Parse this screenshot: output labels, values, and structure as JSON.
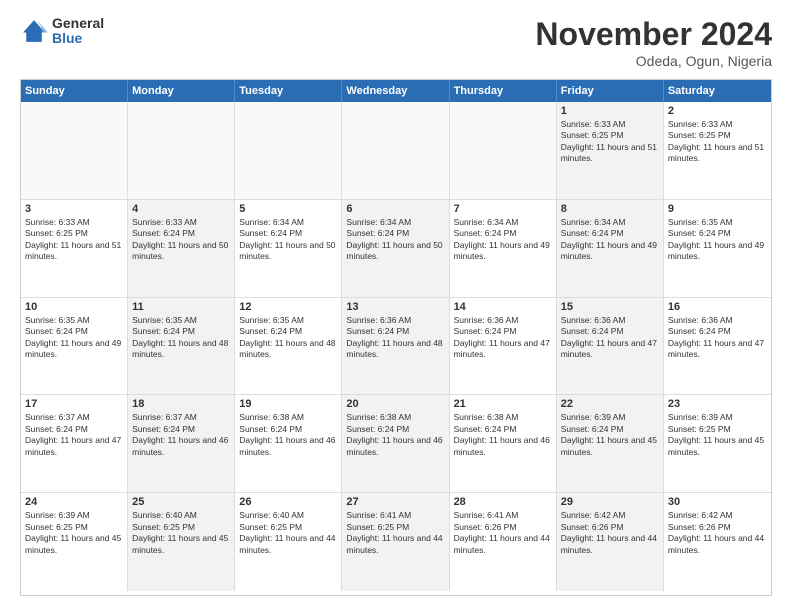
{
  "logo": {
    "general": "General",
    "blue": "Blue"
  },
  "header": {
    "title": "November 2024",
    "location": "Odeda, Ogun, Nigeria"
  },
  "days_of_week": [
    "Sunday",
    "Monday",
    "Tuesday",
    "Wednesday",
    "Thursday",
    "Friday",
    "Saturday"
  ],
  "weeks": [
    [
      {
        "day": "",
        "info": "",
        "empty": true
      },
      {
        "day": "",
        "info": "",
        "empty": true
      },
      {
        "day": "",
        "info": "",
        "empty": true
      },
      {
        "day": "",
        "info": "",
        "empty": true
      },
      {
        "day": "",
        "info": "",
        "empty": true
      },
      {
        "day": "1",
        "info": "Sunrise: 6:33 AM\nSunset: 6:25 PM\nDaylight: 11 hours and 51 minutes.",
        "shaded": true
      },
      {
        "day": "2",
        "info": "Sunrise: 6:33 AM\nSunset: 6:25 PM\nDaylight: 11 hours and 51 minutes.",
        "shaded": false
      }
    ],
    [
      {
        "day": "3",
        "info": "Sunrise: 6:33 AM\nSunset: 6:25 PM\nDaylight: 11 hours and 51 minutes.",
        "shaded": false
      },
      {
        "day": "4",
        "info": "Sunrise: 6:33 AM\nSunset: 6:24 PM\nDaylight: 11 hours and 50 minutes.",
        "shaded": true
      },
      {
        "day": "5",
        "info": "Sunrise: 6:34 AM\nSunset: 6:24 PM\nDaylight: 11 hours and 50 minutes.",
        "shaded": false
      },
      {
        "day": "6",
        "info": "Sunrise: 6:34 AM\nSunset: 6:24 PM\nDaylight: 11 hours and 50 minutes.",
        "shaded": true
      },
      {
        "day": "7",
        "info": "Sunrise: 6:34 AM\nSunset: 6:24 PM\nDaylight: 11 hours and 49 minutes.",
        "shaded": false
      },
      {
        "day": "8",
        "info": "Sunrise: 6:34 AM\nSunset: 6:24 PM\nDaylight: 11 hours and 49 minutes.",
        "shaded": true
      },
      {
        "day": "9",
        "info": "Sunrise: 6:35 AM\nSunset: 6:24 PM\nDaylight: 11 hours and 49 minutes.",
        "shaded": false
      }
    ],
    [
      {
        "day": "10",
        "info": "Sunrise: 6:35 AM\nSunset: 6:24 PM\nDaylight: 11 hours and 49 minutes.",
        "shaded": false
      },
      {
        "day": "11",
        "info": "Sunrise: 6:35 AM\nSunset: 6:24 PM\nDaylight: 11 hours and 48 minutes.",
        "shaded": true
      },
      {
        "day": "12",
        "info": "Sunrise: 6:35 AM\nSunset: 6:24 PM\nDaylight: 11 hours and 48 minutes.",
        "shaded": false
      },
      {
        "day": "13",
        "info": "Sunrise: 6:36 AM\nSunset: 6:24 PM\nDaylight: 11 hours and 48 minutes.",
        "shaded": true
      },
      {
        "day": "14",
        "info": "Sunrise: 6:36 AM\nSunset: 6:24 PM\nDaylight: 11 hours and 47 minutes.",
        "shaded": false
      },
      {
        "day": "15",
        "info": "Sunrise: 6:36 AM\nSunset: 6:24 PM\nDaylight: 11 hours and 47 minutes.",
        "shaded": true
      },
      {
        "day": "16",
        "info": "Sunrise: 6:36 AM\nSunset: 6:24 PM\nDaylight: 11 hours and 47 minutes.",
        "shaded": false
      }
    ],
    [
      {
        "day": "17",
        "info": "Sunrise: 6:37 AM\nSunset: 6:24 PM\nDaylight: 11 hours and 47 minutes.",
        "shaded": false
      },
      {
        "day": "18",
        "info": "Sunrise: 6:37 AM\nSunset: 6:24 PM\nDaylight: 11 hours and 46 minutes.",
        "shaded": true
      },
      {
        "day": "19",
        "info": "Sunrise: 6:38 AM\nSunset: 6:24 PM\nDaylight: 11 hours and 46 minutes.",
        "shaded": false
      },
      {
        "day": "20",
        "info": "Sunrise: 6:38 AM\nSunset: 6:24 PM\nDaylight: 11 hours and 46 minutes.",
        "shaded": true
      },
      {
        "day": "21",
        "info": "Sunrise: 6:38 AM\nSunset: 6:24 PM\nDaylight: 11 hours and 46 minutes.",
        "shaded": false
      },
      {
        "day": "22",
        "info": "Sunrise: 6:39 AM\nSunset: 6:24 PM\nDaylight: 11 hours and 45 minutes.",
        "shaded": true
      },
      {
        "day": "23",
        "info": "Sunrise: 6:39 AM\nSunset: 6:25 PM\nDaylight: 11 hours and 45 minutes.",
        "shaded": false
      }
    ],
    [
      {
        "day": "24",
        "info": "Sunrise: 6:39 AM\nSunset: 6:25 PM\nDaylight: 11 hours and 45 minutes.",
        "shaded": false
      },
      {
        "day": "25",
        "info": "Sunrise: 6:40 AM\nSunset: 6:25 PM\nDaylight: 11 hours and 45 minutes.",
        "shaded": true
      },
      {
        "day": "26",
        "info": "Sunrise: 6:40 AM\nSunset: 6:25 PM\nDaylight: 11 hours and 44 minutes.",
        "shaded": false
      },
      {
        "day": "27",
        "info": "Sunrise: 6:41 AM\nSunset: 6:25 PM\nDaylight: 11 hours and 44 minutes.",
        "shaded": true
      },
      {
        "day": "28",
        "info": "Sunrise: 6:41 AM\nSunset: 6:26 PM\nDaylight: 11 hours and 44 minutes.",
        "shaded": false
      },
      {
        "day": "29",
        "info": "Sunrise: 6:42 AM\nSunset: 6:26 PM\nDaylight: 11 hours and 44 minutes.",
        "shaded": true
      },
      {
        "day": "30",
        "info": "Sunrise: 6:42 AM\nSunset: 6:26 PM\nDaylight: 11 hours and 44 minutes.",
        "shaded": false
      }
    ]
  ]
}
